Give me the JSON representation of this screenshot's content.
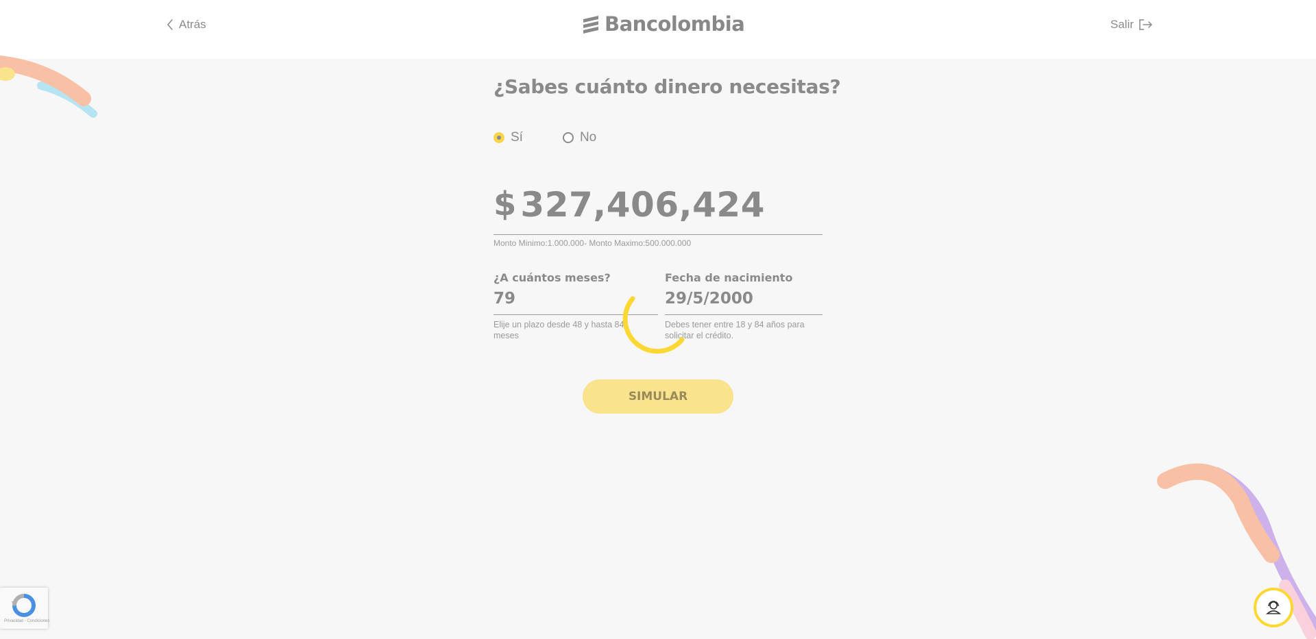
{
  "header": {
    "back_label": "Atrás",
    "logo_text": "Bancolombia",
    "logout_label": "Salir"
  },
  "main": {
    "title": "¿Sabes cuánto dinero necesitas?",
    "radio_options": [
      {
        "label": "Sí",
        "selected": true
      },
      {
        "label": "No",
        "selected": false
      }
    ],
    "amount": {
      "currency": "$",
      "value": "327,406,424",
      "hint": "Monto Minimo:1.000.000- Monto Maximo:500.000.000"
    },
    "months": {
      "label": "¿A cuántos meses?",
      "value": "79",
      "hint": "Elije un plazo desde 48 y hasta 84 meses"
    },
    "birthdate": {
      "label": "Fecha de nacimiento",
      "value": "29/5/2000",
      "hint": "Debes tener entre 18 y 84 años para solicitar el crédito."
    },
    "simulate_label": "SIMULAR"
  },
  "recaptcha": {
    "text": "Privacidad - Condiciones",
    "icon": "recaptcha-icon"
  },
  "help": {
    "icon": "support-agent-icon"
  },
  "colors": {
    "accent": "#fdd835",
    "button_bg": "#f9e38c",
    "text": "#8a8a8a",
    "background": "#f7f7f7"
  }
}
